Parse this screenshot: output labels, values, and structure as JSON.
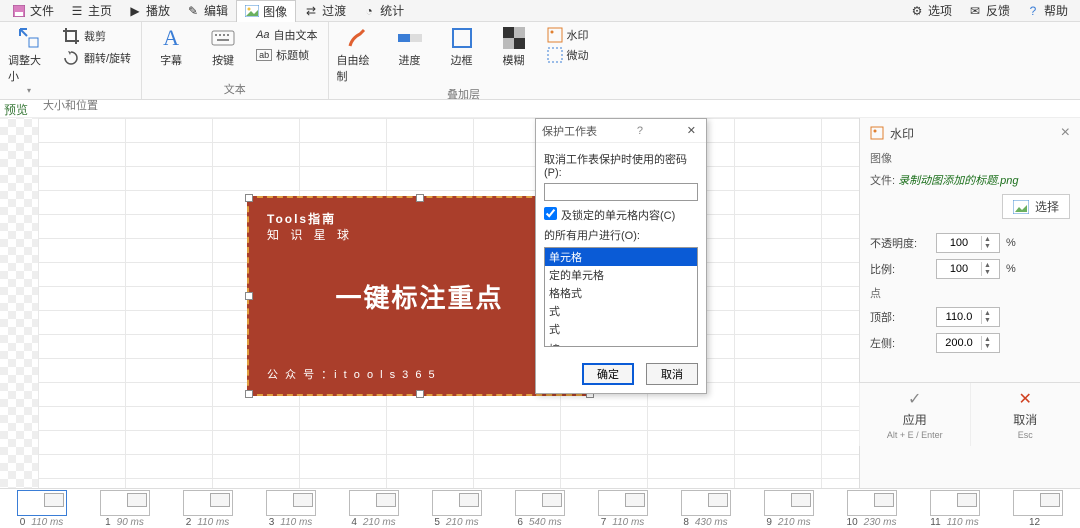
{
  "menubar": {
    "items": [
      "文件",
      "主页",
      "播放",
      "编辑",
      "图像",
      "过渡",
      "统计"
    ],
    "active_index": 4,
    "right": [
      "选项",
      "反馈",
      "帮助"
    ]
  },
  "ribbon": {
    "groups": [
      {
        "label": "大小和位置",
        "kind": "size"
      },
      {
        "label": "文本",
        "kind": "text"
      },
      {
        "label": "叠加层",
        "kind": "overlay"
      }
    ],
    "size": {
      "resize": "调整大小",
      "crop": "裁剪",
      "rotate": "翻转/旋转"
    },
    "text": {
      "caption": "字幕",
      "keys": "按键",
      "freetext": "自由文本",
      "titleframe": "标题帧"
    },
    "overlay": {
      "freedraw": "自由绘制",
      "progress": "进度",
      "border": "边框",
      "blur": "模糊",
      "watermark": "水印",
      "micro": "微动"
    }
  },
  "preview": {
    "label": "预览"
  },
  "card": {
    "t1": "Tools指南",
    "t2": "知 识 星 球",
    "big": "一键标注重点",
    "foot": "公 众 号 ：i t o o l s 3 6 5"
  },
  "dialog": {
    "title": "保护工作表",
    "help": "?",
    "pwd_label": "取消工作表保护时使用的密码(P):",
    "check1": "及锁定的单元格内容(C)",
    "allow_label": "的所有用户进行(O):",
    "options": [
      "单元格",
      "定的单元格",
      "格格式",
      "式",
      "式",
      "",
      "接"
    ],
    "selected_index": 0,
    "ok": "确定",
    "cancel": "取消"
  },
  "side": {
    "title": "水印",
    "section_image": "图像",
    "file_label": "文件:",
    "file_name": "录制动图添加的标题.png",
    "choose": "选择",
    "opacity_label": "不透明度:",
    "opacity_value": "100",
    "scale_label": "比例:",
    "scale_value": "100",
    "percent": "%",
    "point_label": "点",
    "top_label": "顶部:",
    "top_value": "110.0",
    "left_label": "左侧:",
    "left_value": "200.0",
    "apply": "应用",
    "apply_hint": "Alt + E / Enter",
    "cancel": "取消",
    "cancel_hint": "Esc"
  },
  "timeline": {
    "frames": [
      {
        "idx": "0",
        "ms": "110 ms"
      },
      {
        "idx": "1",
        "ms": "90 ms"
      },
      {
        "idx": "2",
        "ms": "110 ms"
      },
      {
        "idx": "3",
        "ms": "110 ms"
      },
      {
        "idx": "4",
        "ms": "210 ms"
      },
      {
        "idx": "5",
        "ms": "210 ms"
      },
      {
        "idx": "6",
        "ms": "540 ms"
      },
      {
        "idx": "7",
        "ms": "110 ms"
      },
      {
        "idx": "8",
        "ms": "430 ms"
      },
      {
        "idx": "9",
        "ms": "210 ms"
      },
      {
        "idx": "10",
        "ms": "230 ms"
      },
      {
        "idx": "11",
        "ms": "110 ms"
      },
      {
        "idx": "12",
        "ms": ""
      }
    ],
    "selected_index": 0
  }
}
